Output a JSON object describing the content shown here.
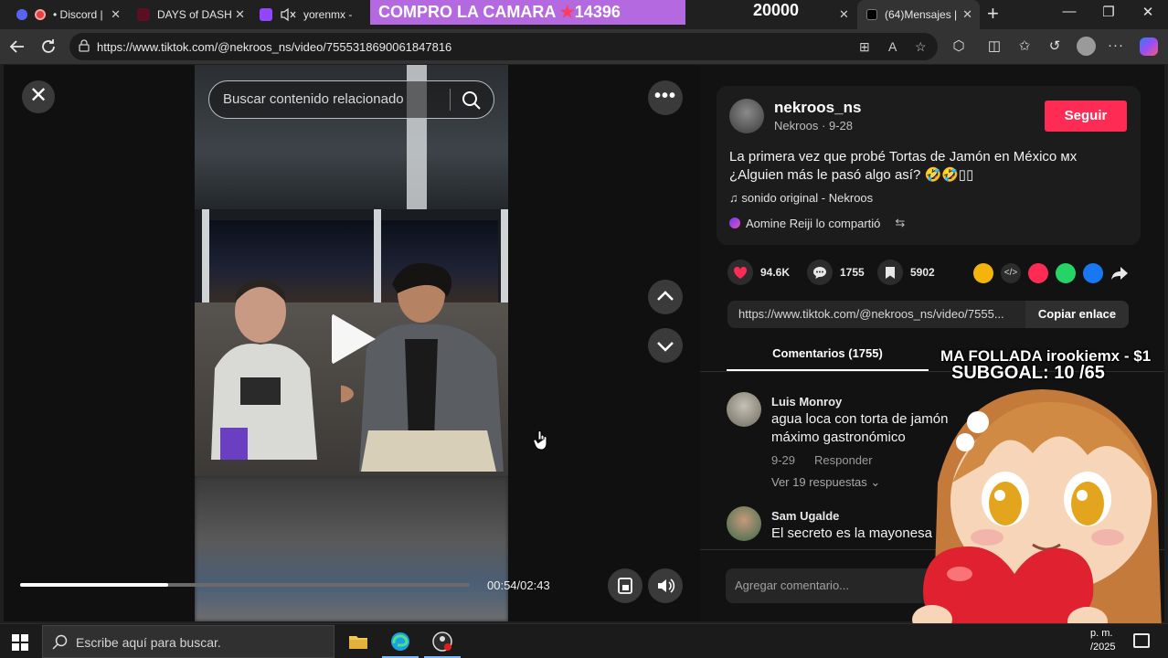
{
  "browser": {
    "tabs": [
      {
        "label": "• Discord |",
        "close": "✕"
      },
      {
        "label": "DAYS of DASH",
        "close": "✕"
      },
      {
        "label": "yorenmx -",
        "close": ""
      },
      {
        "label": "(64)Mensajes |",
        "close": "✕"
      }
    ],
    "stream_banner": {
      "text_a": "COMPRO LA CAMARA ",
      "text_b": "14396",
      "star": "★"
    },
    "stream_counter": "20000",
    "tab_close_mid": "✕",
    "new_tab": "+",
    "window_controls": {
      "minimize": "—",
      "maximize": "❐",
      "close": "✕"
    },
    "url": "https://www.tiktok.com/@nekroos_ns/video/7555318690061847816"
  },
  "video": {
    "search_placeholder": "Buscar contenido relacionado",
    "close_glyph": "✕",
    "more_glyph": "•••",
    "time": "00:54/02:43",
    "progress": 0.33
  },
  "author": {
    "username": "nekroos_ns",
    "subtitle": "Nekroos · 9-28",
    "follow_label": "Seguir",
    "description": "La primera vez que probé Tortas de Jamón en México ᴍx ¿Alguien más le pasó algo así? 🤣🤣▯▯",
    "music": "♫   sonido original - Nekroos",
    "shared": "Aomine Reiji lo compartió",
    "shared_icon": "⇆"
  },
  "stats": {
    "likes": "94.6K",
    "comments": "1755",
    "saves": "5902"
  },
  "share": {
    "link_text": "https://www.tiktok.com/@nekroos_ns/video/7555...",
    "copy_label": "Copiar enlace"
  },
  "comments_tab": {
    "label": "Comentarios (1755)"
  },
  "comments": [
    {
      "name": "Luis Monroy",
      "text_line1": "agua loca con torta de jamón",
      "text_line2": "máximo gastronómico",
      "date": "9-29",
      "reply_label": "Responder",
      "replies": "Ver 19 respuestas  ⌄"
    },
    {
      "name": "Sam Ugalde",
      "text": "El secreto es la mayonesa"
    }
  ],
  "comment_input_placeholder": "Agregar comentario...",
  "stream_overlay": {
    "line1": "MA FOLLADA irookiemx - $1",
    "line2": "SUBGOAL: 10 /65"
  },
  "taskbar": {
    "search_placeholder": "Escribe aquí para buscar.",
    "time_line1": "p. m.",
    "time_line2": "/2025"
  },
  "colors": {
    "accent": "#fe2c55",
    "banner": "#b469e0",
    "panel": "#121212",
    "card": "#1c1c1c"
  },
  "icons": {
    "back": "back-arrow-icon",
    "reload": "reload-icon",
    "search": "magnifier-icon",
    "play": "play-icon",
    "heart": "heart-icon",
    "comment": "comment-bubble-icon",
    "bookmark": "bookmark-icon"
  }
}
